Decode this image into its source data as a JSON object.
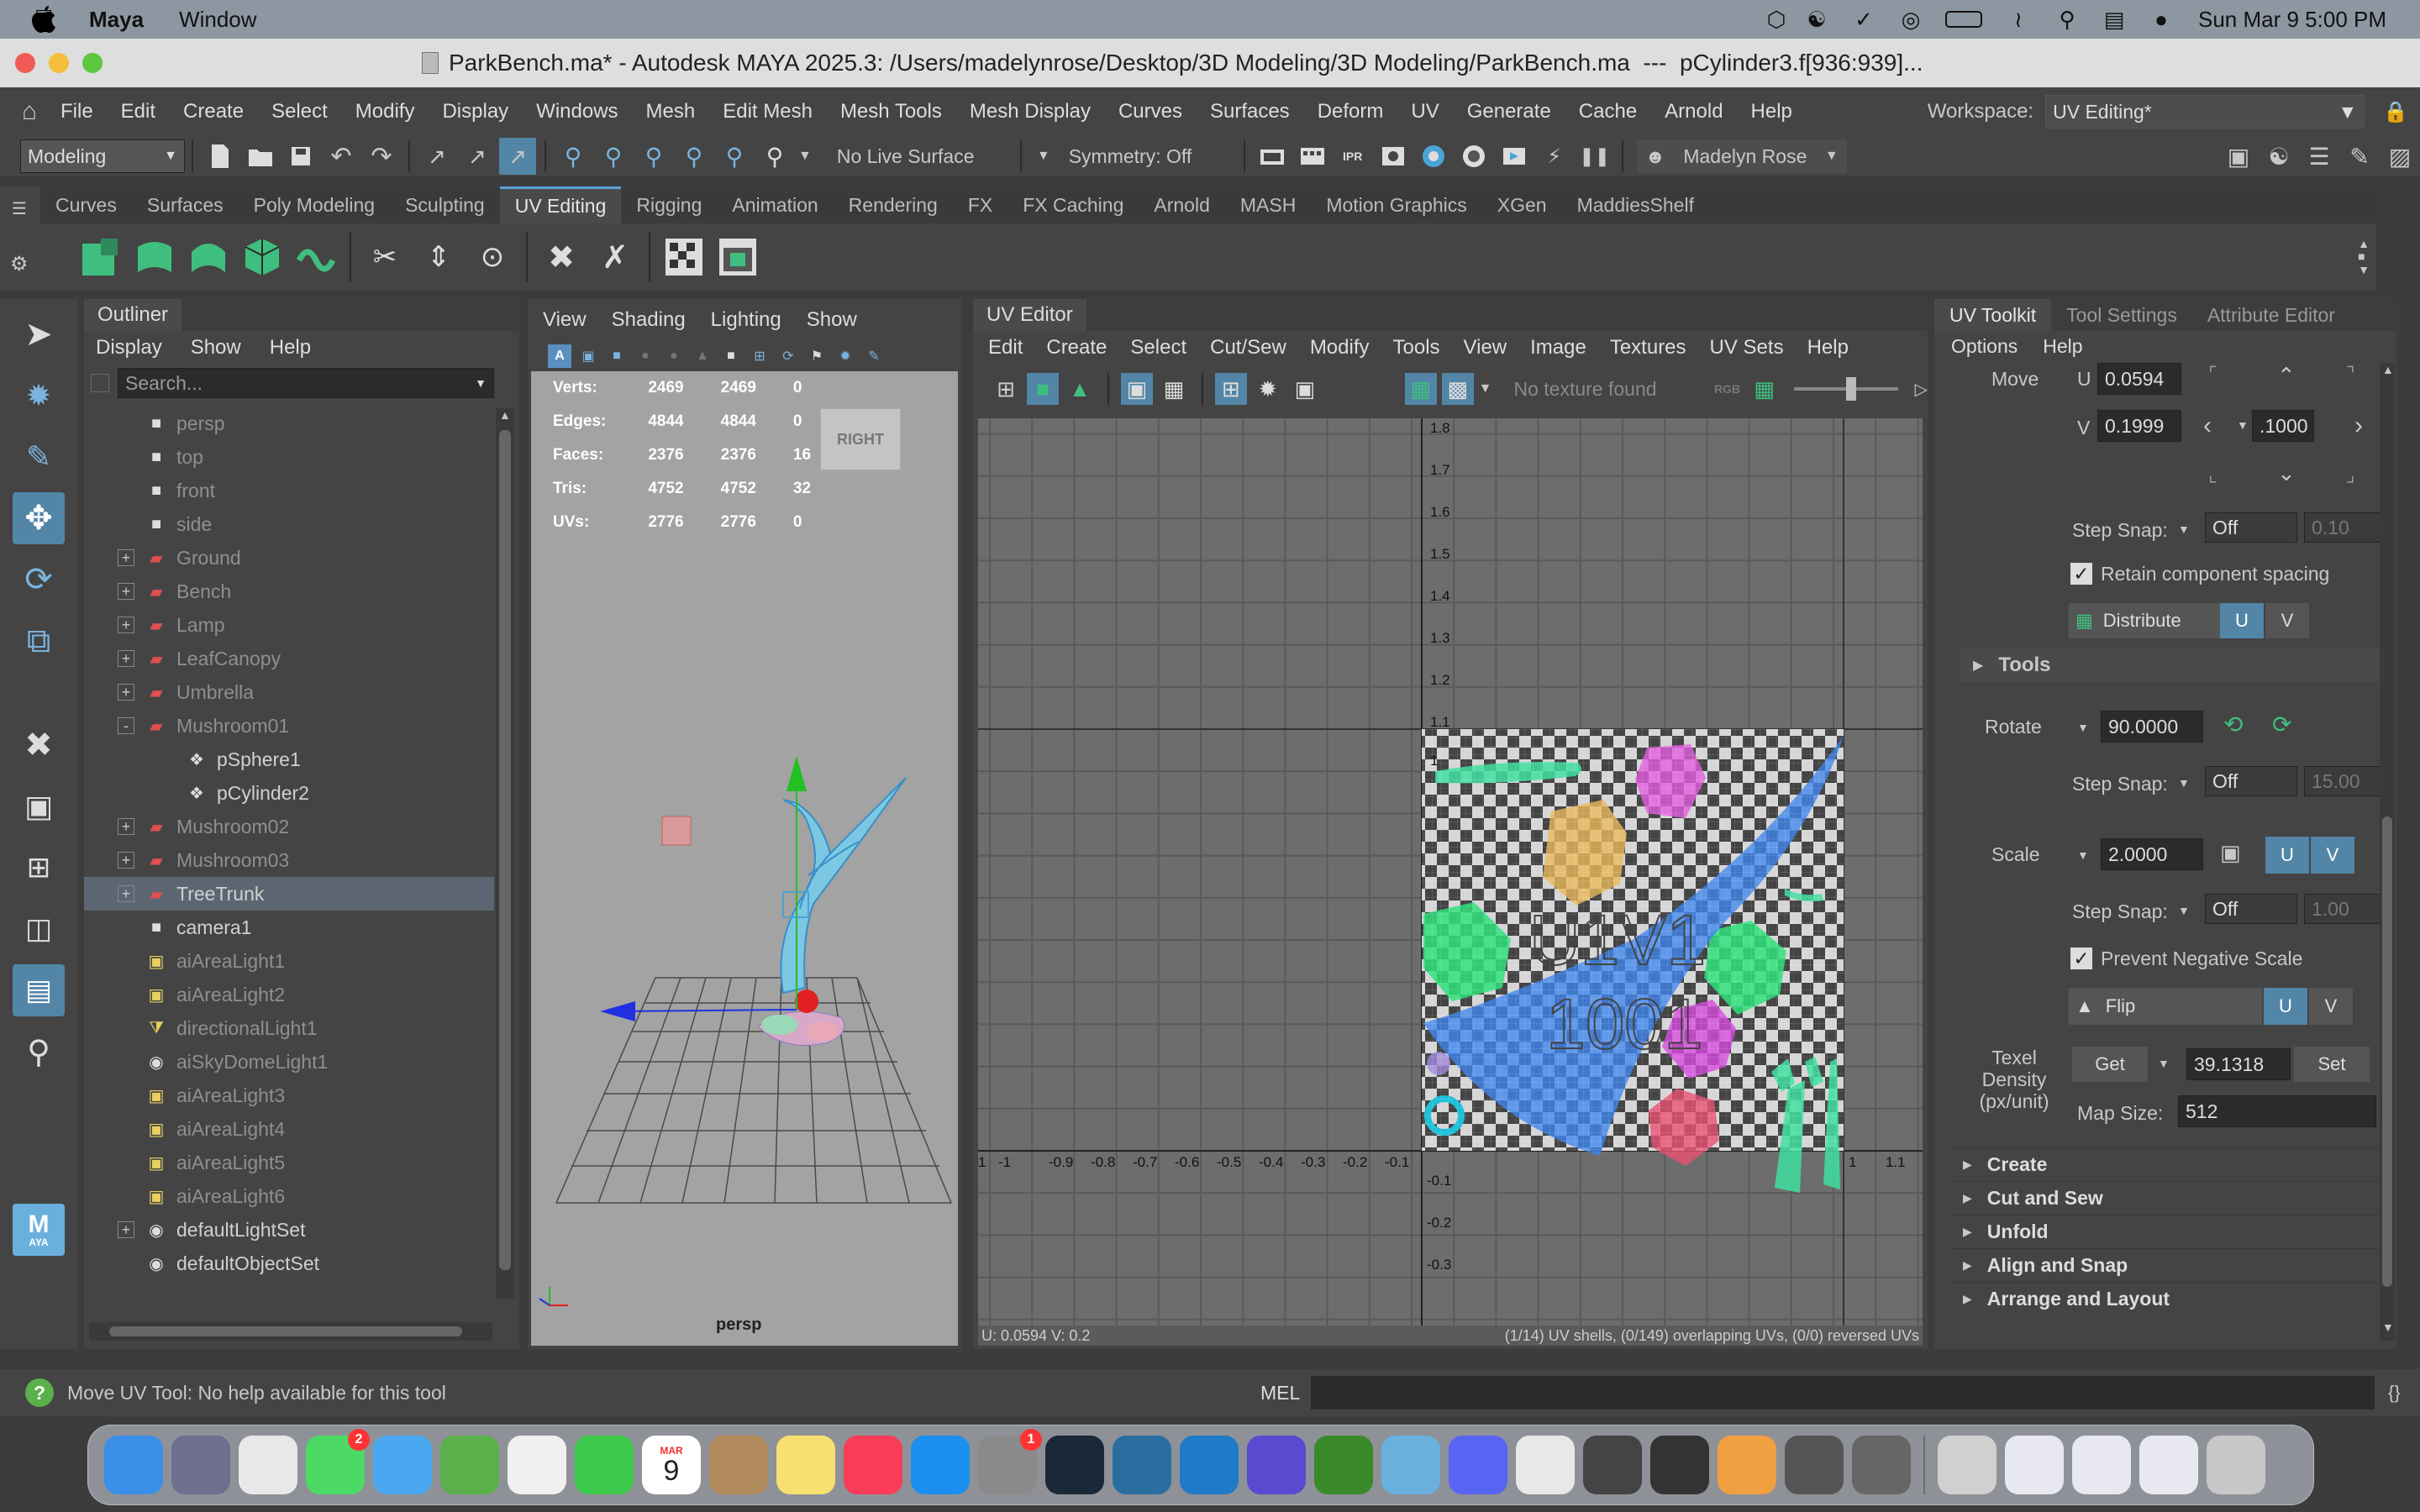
{
  "mac": {
    "app": "Maya",
    "menu_window": "Window",
    "datetime": "Sun Mar 9  5:00 PM"
  },
  "title": "ParkBench.ma* - Autodesk MAYA 2025.3: /Users/madelynrose/Desktop/3D Modeling/3D Modeling/ParkBench.ma  ---  pCylinder3.f[936:939]...",
  "menus": [
    "File",
    "Edit",
    "Create",
    "Select",
    "Modify",
    "Display",
    "Windows",
    "Mesh",
    "Edit Mesh",
    "Mesh Tools",
    "Mesh Display",
    "Curves",
    "Surfaces",
    "Deform",
    "UV",
    "Generate",
    "Cache",
    "Arnold",
    "Help"
  ],
  "workspace": {
    "label": "Workspace:",
    "value": "UV Editing*"
  },
  "status": {
    "mode": "Modeling",
    "live_surface": "No Live Surface",
    "symmetry": "Symmetry: Off",
    "user": "Madelyn Rose"
  },
  "shelf_tabs": [
    "Curves",
    "Surfaces",
    "Poly Modeling",
    "Sculpting",
    "UV Editing",
    "Rigging",
    "Animation",
    "Rendering",
    "FX",
    "FX Caching",
    "Arnold",
    "MASH",
    "Motion Graphics",
    "XGen",
    "MaddiesShelf"
  ],
  "active_shelf": "UV Editing",
  "outliner": {
    "title": "Outliner",
    "menu": [
      "Display",
      "Show",
      "Help"
    ],
    "search_placeholder": "Search...",
    "items": [
      {
        "label": "persp",
        "indent": 1,
        "icon": "camera-icon",
        "expand": false,
        "dim": true
      },
      {
        "label": "top",
        "indent": 1,
        "icon": "camera-icon",
        "expand": false,
        "dim": true
      },
      {
        "label": "front",
        "indent": 1,
        "icon": "camera-icon",
        "expand": false,
        "dim": true
      },
      {
        "label": "side",
        "indent": 1,
        "icon": "camera-icon",
        "expand": false,
        "dim": true
      },
      {
        "label": "Ground",
        "indent": 1,
        "icon": "group-icon",
        "expand": "+",
        "dim": true
      },
      {
        "label": "Bench",
        "indent": 1,
        "icon": "group-icon",
        "expand": "+",
        "dim": true
      },
      {
        "label": "Lamp",
        "indent": 1,
        "icon": "group-icon",
        "expand": "+",
        "dim": true
      },
      {
        "label": "LeafCanopy",
        "indent": 1,
        "icon": "group-icon",
        "expand": "+",
        "dim": true
      },
      {
        "label": "Umbrella",
        "indent": 1,
        "icon": "group-icon",
        "expand": "+",
        "dim": true
      },
      {
        "label": "Mushroom01",
        "indent": 1,
        "icon": "group-icon",
        "expand": "-",
        "dim": true
      },
      {
        "label": "pSphere1",
        "indent": 2,
        "icon": "mesh-icon",
        "expand": false,
        "dim": false
      },
      {
        "label": "pCylinder2",
        "indent": 2,
        "icon": "mesh-icon",
        "expand": false,
        "dim": false
      },
      {
        "label": "Mushroom02",
        "indent": 1,
        "icon": "group-icon",
        "expand": "+",
        "dim": true
      },
      {
        "label": "Mushroom03",
        "indent": 1,
        "icon": "group-icon",
        "expand": "+",
        "dim": true
      },
      {
        "label": "TreeTrunk",
        "indent": 1,
        "icon": "group-icon",
        "expand": "+",
        "dim": false,
        "selected": true
      },
      {
        "label": "camera1",
        "indent": 1,
        "icon": "camera-icon",
        "expand": false,
        "dim": false
      },
      {
        "label": "aiAreaLight1",
        "indent": 1,
        "icon": "light-icon",
        "expand": false,
        "dim": true
      },
      {
        "label": "aiAreaLight2",
        "indent": 1,
        "icon": "light-icon",
        "expand": false,
        "dim": true
      },
      {
        "label": "directionalLight1",
        "indent": 1,
        "icon": "directional-light-icon",
        "expand": false,
        "dim": true
      },
      {
        "label": "aiSkyDomeLight1",
        "indent": 1,
        "icon": "skydome-icon",
        "expand": false,
        "dim": true
      },
      {
        "label": "aiAreaLight3",
        "indent": 1,
        "icon": "light-icon",
        "expand": false,
        "dim": true
      },
      {
        "label": "aiAreaLight4",
        "indent": 1,
        "icon": "light-icon",
        "expand": false,
        "dim": true
      },
      {
        "label": "aiAreaLight5",
        "indent": 1,
        "icon": "light-icon",
        "expand": false,
        "dim": true
      },
      {
        "label": "aiAreaLight6",
        "indent": 1,
        "icon": "light-icon",
        "expand": false,
        "dim": true
      },
      {
        "label": "defaultLightSet",
        "indent": 1,
        "icon": "set-icon",
        "expand": "+",
        "dim": false
      },
      {
        "label": "defaultObjectSet",
        "indent": 1,
        "icon": "set-icon",
        "expand": false,
        "dim": false
      }
    ]
  },
  "viewport": {
    "menu": [
      "View",
      "Shading",
      "Lighting",
      "Show"
    ],
    "hud": [
      [
        "Verts:",
        "2469",
        "2469",
        "0"
      ],
      [
        "Edges:",
        "4844",
        "4844",
        "0"
      ],
      [
        "Faces:",
        "2376",
        "2376",
        "16"
      ],
      [
        "Tris:",
        "4752",
        "4752",
        "32"
      ],
      [
        "UVs:",
        "2776",
        "2776",
        "0"
      ]
    ],
    "cube": "RIGHT",
    "camera": "persp"
  },
  "uv": {
    "title": "UV Editor",
    "menu": [
      "Edit",
      "Create",
      "Select",
      "Cut/Sew",
      "Modify",
      "Tools",
      "View",
      "Image",
      "Textures",
      "UV Sets",
      "Help"
    ],
    "no_texture": "No texture found",
    "vticks": [
      "1.8",
      "1.7",
      "1.6",
      "1.5",
      "1.4",
      "1.3",
      "1.2",
      "1.1",
      "1",
      "-0.1",
      "-0.2",
      "-0.3"
    ],
    "hticks": [
      "1",
      "-1",
      "-0.9",
      "-0.8",
      "-0.7",
      "-0.6",
      "-0.5",
      "-0.4",
      "-0.3",
      "-0.2",
      "-0.1",
      "1",
      "1.1"
    ],
    "tile_label1": "U1V1",
    "tile_label2": "1001",
    "status_left": "U: 0.0594  V: 0.2",
    "status_right": "(1/14) UV shells, (0/149) overlapping UVs, (0/0) reversed UVs"
  },
  "toolkit": {
    "tabs": [
      "UV Toolkit",
      "Tool Settings",
      "Attribute Editor"
    ],
    "menu": [
      "Options",
      "Help"
    ],
    "move": {
      "label": "Move",
      "u_label": "U",
      "u": "0.0594",
      "v_label": "V",
      "v": "0.1999",
      "step": ".1000"
    },
    "step_snap": "Step Snap:",
    "off": "Off",
    "snap1": "0.10",
    "retain": "Retain component spacing",
    "distribute": "Distribute",
    "u": "U",
    "v": "V",
    "tools": "Tools",
    "rotate": {
      "label": "Rotate",
      "value": "90.0000",
      "snap": "15.00"
    },
    "scale": {
      "label": "Scale",
      "value": "2.0000",
      "snap": "1.00"
    },
    "prevent": "Prevent Negative Scale",
    "flip": "Flip",
    "texel": {
      "label": "Texel Density (px/unit)",
      "get": "Get",
      "value": "39.1318",
      "set": "Set",
      "map_label": "Map Size:",
      "map_value": "512"
    },
    "sections": [
      "Create",
      "Cut and Sew",
      "Unfold",
      "Align and Snap",
      "Arrange and Layout"
    ]
  },
  "bottom": {
    "help": "Move UV Tool: No help available for this tool",
    "mel": "MEL"
  },
  "dock": [
    "Finder",
    "Launchpad",
    "Chrome",
    "Messages",
    "Mail",
    "Maps",
    "Photos",
    "FaceTime",
    "Calendar",
    "Contacts",
    "Notes",
    "Music",
    "App Store",
    "System Settings",
    "Steam",
    "Godot",
    "VS Code",
    "Blender Launcher",
    "Minecraft",
    "Maya",
    "Discord",
    "Perforce",
    "Unity",
    "Unity Hub",
    "Pages",
    "Unity 2",
    "Unity 3",
    "Preview",
    "Documents",
    "Downloads",
    "Screenshots",
    "Trash"
  ],
  "dock_badges": {
    "Messages": "2",
    "System Settings": "1"
  },
  "calendar": {
    "month": "MAR",
    "day": "9"
  }
}
